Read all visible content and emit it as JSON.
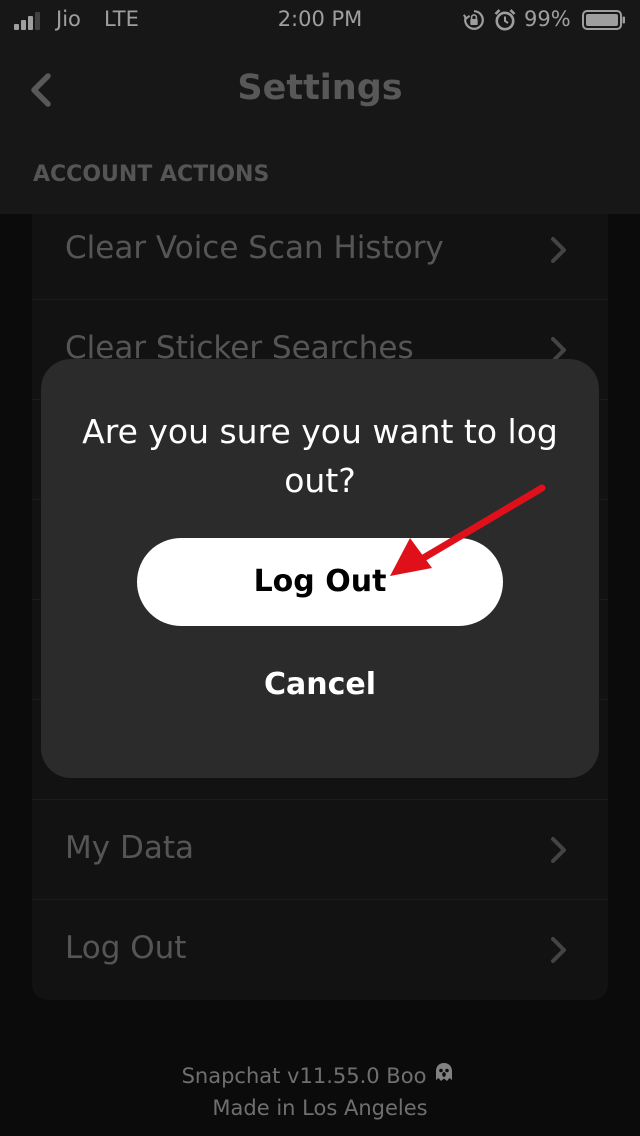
{
  "status_bar": {
    "carrier": "Jio",
    "network": "LTE",
    "time": "2:00 PM",
    "battery_percent": "99%",
    "signal_bars": 3,
    "signal_bars_total": 4,
    "icons": [
      "signal-icon",
      "lock-rotation-icon",
      "alarm-icon",
      "battery-icon"
    ]
  },
  "header": {
    "back_icon": "chevron-left-icon",
    "title": "Settings",
    "section_title": "ACCOUNT ACTIONS"
  },
  "settings_list": {
    "items": [
      {
        "label": "Clear Voice Scan History",
        "icon": "chevron-right-icon"
      },
      {
        "label": "Clear Sticker Searches",
        "icon": "chevron-right-icon"
      },
      {
        "label": "My Data",
        "icon": "chevron-right-icon"
      },
      {
        "label": "Log Out",
        "icon": "chevron-right-icon"
      }
    ]
  },
  "modal": {
    "message": "Are you sure you want to log out?",
    "confirm_label": "Log Out",
    "cancel_label": "Cancel",
    "annotation": "red-arrow-pointing-at-log-out-button"
  },
  "footer": {
    "version": "Snapchat v11.55.0 Boo",
    "tagline": "Made in Los Angeles",
    "icon": "ghost-icon"
  },
  "colors": {
    "background": "#121212",
    "bar": "#262626",
    "card": "#1e1e1e",
    "modal": "#2b2b2b",
    "annotation_arrow": "#e0101a"
  }
}
